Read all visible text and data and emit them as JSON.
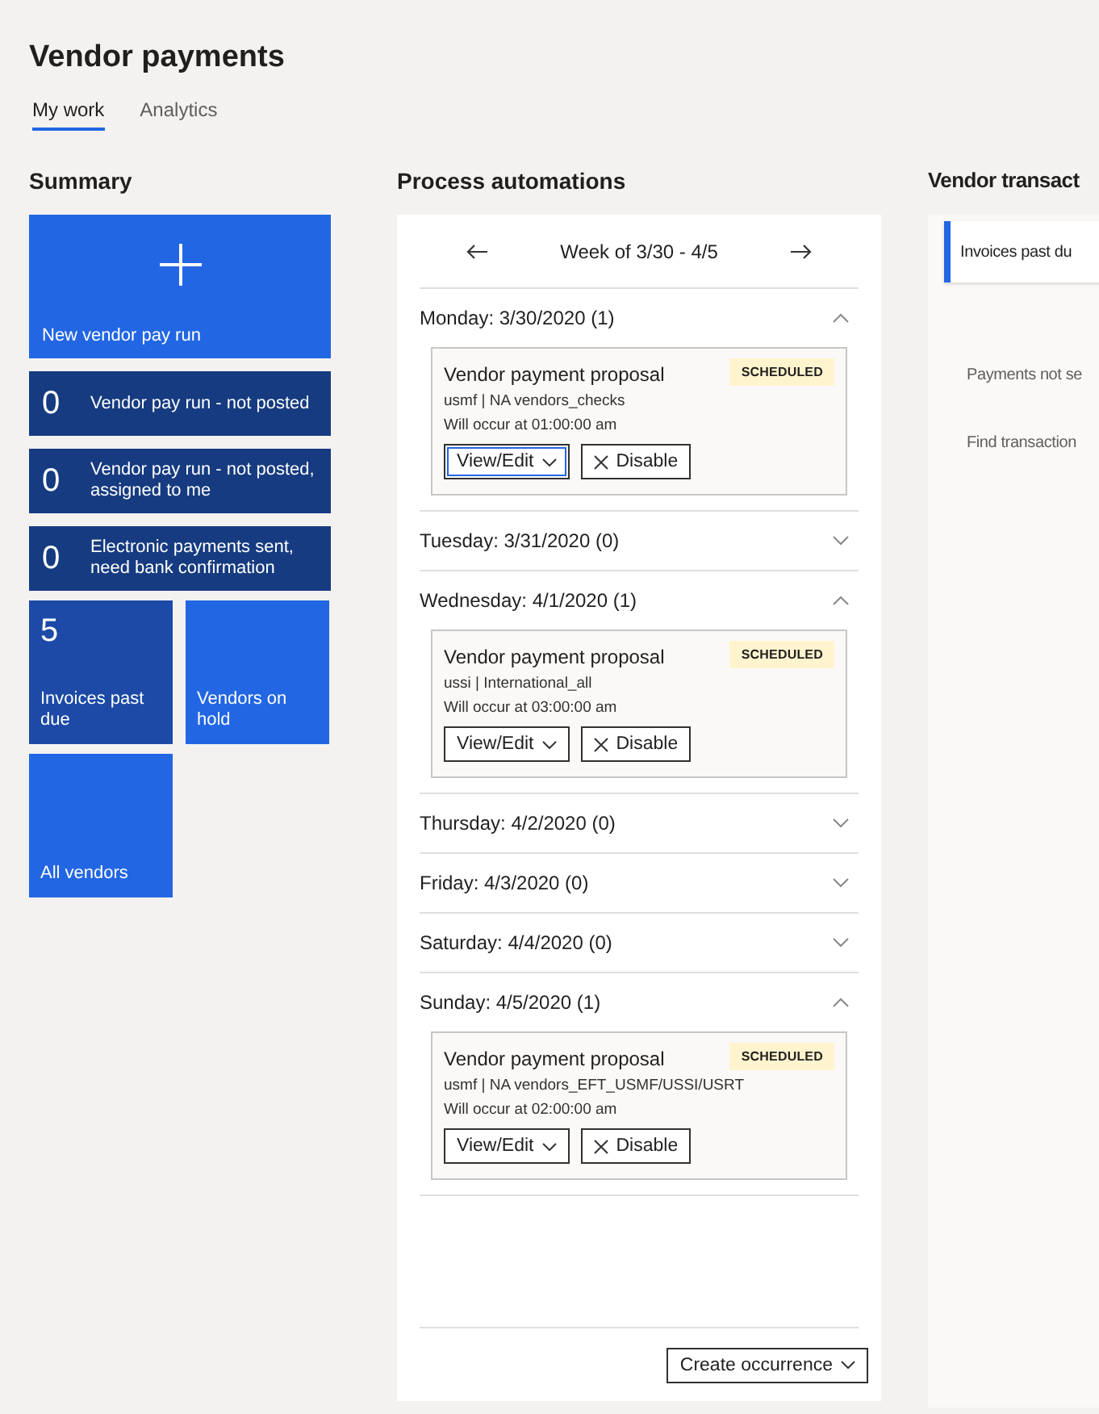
{
  "page": {
    "title": "Vendor payments"
  },
  "tabs": [
    {
      "label": "My work",
      "selected": true
    },
    {
      "label": "Analytics",
      "selected": false
    }
  ],
  "summary": {
    "title": "Summary",
    "tiles": [
      {
        "kind": "action",
        "label": "New vendor pay run",
        "color": "#2266e3"
      },
      {
        "kind": "wide",
        "count": "0",
        "label": "Vendor pay run - not posted",
        "color": "#163b80"
      },
      {
        "kind": "wide",
        "count": "0",
        "label": "Vendor pay run - not posted, assigned to me",
        "color": "#163b80"
      },
      {
        "kind": "wide",
        "count": "0",
        "label": "Electronic payments sent, need bank confirmation",
        "color": "#163b80"
      },
      {
        "kind": "small",
        "count": "5",
        "label": "Invoices past due",
        "color": "#1c4aa6"
      },
      {
        "kind": "small",
        "label": "Vendors on hold",
        "color": "#2266e3"
      },
      {
        "kind": "small",
        "label": "All vendors",
        "color": "#2266e3"
      }
    ]
  },
  "process": {
    "title": "Process automations",
    "week": "Week of 3/30 - 4/5",
    "days": [
      {
        "label": "Monday: 3/30/2020 (1)",
        "expanded": true,
        "occurrences": [
          {
            "title": "Vendor payment proposal",
            "status": "SCHEDULED",
            "detail": "usmf | NA vendors_checks",
            "time": "Will occur at 01:00:00 am",
            "view_button": {
              "label": "View/Edit",
              "focused": true
            },
            "disable_button": "Disable"
          }
        ]
      },
      {
        "label": "Tuesday: 3/31/2020 (0)",
        "expanded": false
      },
      {
        "label": "Wednesday: 4/1/2020 (1)",
        "expanded": true,
        "occurrences": [
          {
            "title": "Vendor payment proposal",
            "status": "SCHEDULED",
            "detail": "ussi | International_all",
            "time": "Will occur at 03:00:00 am",
            "view_button": {
              "label": "View/Edit",
              "focused": false
            },
            "disable_button": "Disable"
          }
        ]
      },
      {
        "label": "Thursday: 4/2/2020 (0)",
        "expanded": false
      },
      {
        "label": "Friday: 4/3/2020 (0)",
        "expanded": false
      },
      {
        "label": "Saturday: 4/4/2020 (0)",
        "expanded": false
      },
      {
        "label": "Sunday: 4/5/2020 (1)",
        "expanded": true,
        "occurrences": [
          {
            "title": "Vendor payment proposal",
            "status": "SCHEDULED",
            "detail": "usmf | NA vendors_EFT_USMF/USSI/USRT",
            "time": "Will occur at 02:00:00 am",
            "view_button": {
              "label": "View/Edit",
              "focused": false
            },
            "disable_button": "Disable"
          }
        ]
      }
    ],
    "create_button": "Create occurrence"
  },
  "transactions": {
    "title": "Vendor transact",
    "items": [
      {
        "label": "Invoices past du",
        "selected": true
      },
      {
        "label": "Payments not se",
        "selected": false
      },
      {
        "label": "Find transaction",
        "selected": false
      }
    ]
  }
}
